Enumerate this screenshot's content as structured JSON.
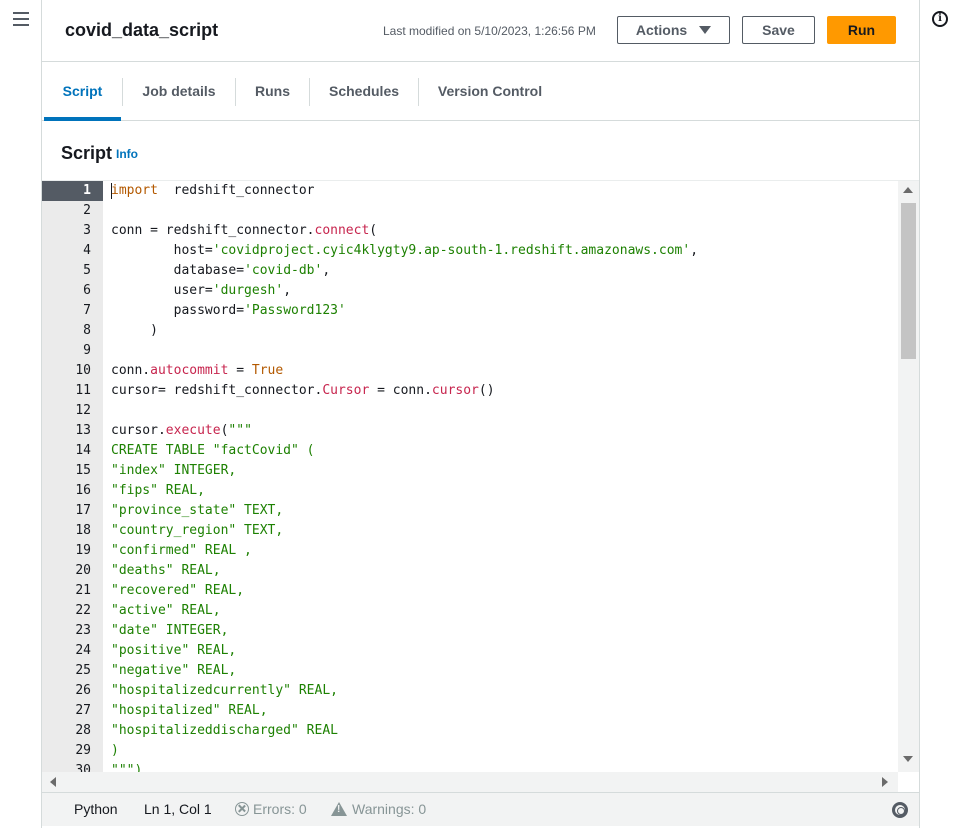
{
  "header": {
    "title": "covid_data_script",
    "last_modified": "Last modified on 5/10/2023, 1:26:56 PM",
    "actions_label": "Actions",
    "save_label": "Save",
    "run_label": "Run"
  },
  "tabs": [
    {
      "label": "Script",
      "active": true
    },
    {
      "label": "Job details",
      "active": false
    },
    {
      "label": "Runs",
      "active": false
    },
    {
      "label": "Schedules",
      "active": false
    },
    {
      "label": "Version Control",
      "active": false
    }
  ],
  "script_section": {
    "title": "Script",
    "info_link": "Info"
  },
  "editor": {
    "current_line": 1,
    "lines": [
      {
        "n": "1",
        "segs": [
          [
            "kw",
            "import"
          ],
          [
            "",
            "  redshift_connector"
          ]
        ]
      },
      {
        "n": "2",
        "segs": [
          [
            "",
            ""
          ]
        ]
      },
      {
        "n": "3",
        "segs": [
          [
            "",
            "conn = redshift_connector."
          ],
          [
            "fn",
            "connect"
          ],
          [
            "",
            "("
          ]
        ]
      },
      {
        "n": "4",
        "segs": [
          [
            "",
            "        host="
          ],
          [
            "str",
            "'covidproject.cyic4klygty9.ap-south-1.redshift.amazonaws.com'"
          ],
          [
            "",
            ","
          ]
        ]
      },
      {
        "n": "5",
        "segs": [
          [
            "",
            "        database="
          ],
          [
            "str",
            "'covid-db'"
          ],
          [
            "",
            ","
          ]
        ]
      },
      {
        "n": "6",
        "segs": [
          [
            "",
            "        user="
          ],
          [
            "str",
            "'durgesh'"
          ],
          [
            "",
            ","
          ]
        ]
      },
      {
        "n": "7",
        "segs": [
          [
            "",
            "        password="
          ],
          [
            "str",
            "'Password123'"
          ]
        ]
      },
      {
        "n": "8",
        "segs": [
          [
            "",
            "     )"
          ]
        ]
      },
      {
        "n": "9",
        "segs": [
          [
            "",
            ""
          ]
        ]
      },
      {
        "n": "10",
        "segs": [
          [
            "",
            "conn."
          ],
          [
            "fn",
            "autocommit"
          ],
          [
            "",
            " = "
          ],
          [
            "kw",
            "True"
          ]
        ]
      },
      {
        "n": "11",
        "segs": [
          [
            "",
            "cursor= redshift_connector."
          ],
          [
            "fn",
            "Cursor"
          ],
          [
            "",
            " = conn."
          ],
          [
            "fn",
            "cursor"
          ],
          [
            "",
            "()"
          ]
        ]
      },
      {
        "n": "12",
        "segs": [
          [
            "",
            ""
          ]
        ]
      },
      {
        "n": "13",
        "segs": [
          [
            "",
            "cursor."
          ],
          [
            "fn",
            "execute"
          ],
          [
            "",
            "("
          ],
          [
            "str",
            "\"\"\""
          ]
        ]
      },
      {
        "n": "14",
        "segs": [
          [
            "str",
            "CREATE TABLE \"factCovid\" ("
          ]
        ]
      },
      {
        "n": "15",
        "segs": [
          [
            "str",
            "\"index\" INTEGER,"
          ]
        ]
      },
      {
        "n": "16",
        "segs": [
          [
            "str",
            "\"fips\" REAL,"
          ]
        ]
      },
      {
        "n": "17",
        "segs": [
          [
            "str",
            "\"province_state\" TEXT,"
          ]
        ]
      },
      {
        "n": "18",
        "segs": [
          [
            "str",
            "\"country_region\" TEXT,"
          ]
        ]
      },
      {
        "n": "19",
        "segs": [
          [
            "str",
            "\"confirmed\" REAL ,"
          ]
        ]
      },
      {
        "n": "20",
        "segs": [
          [
            "str",
            "\"deaths\" REAL,"
          ]
        ]
      },
      {
        "n": "21",
        "segs": [
          [
            "str",
            "\"recovered\" REAL,"
          ]
        ]
      },
      {
        "n": "22",
        "segs": [
          [
            "str",
            "\"active\" REAL,"
          ]
        ]
      },
      {
        "n": "23",
        "segs": [
          [
            "str",
            "\"date\" INTEGER,"
          ]
        ]
      },
      {
        "n": "24",
        "segs": [
          [
            "str",
            "\"positive\" REAL,"
          ]
        ]
      },
      {
        "n": "25",
        "segs": [
          [
            "str",
            "\"negative\" REAL,"
          ]
        ]
      },
      {
        "n": "26",
        "segs": [
          [
            "str",
            "\"hospitalizedcurrently\" REAL,"
          ]
        ]
      },
      {
        "n": "27",
        "segs": [
          [
            "str",
            "\"hospitalized\" REAL,"
          ]
        ]
      },
      {
        "n": "28",
        "segs": [
          [
            "str",
            "\"hospitalizeddischarged\" REAL"
          ]
        ]
      },
      {
        "n": "29",
        "segs": [
          [
            "str",
            ")"
          ]
        ]
      },
      {
        "n": "30",
        "segs": [
          [
            "str",
            "\"\"\")"
          ]
        ]
      }
    ]
  },
  "statusbar": {
    "language": "Python",
    "position": "Ln 1, Col 1",
    "errors": "Errors: 0",
    "warnings": "Warnings: 0"
  },
  "colors": {
    "accent": "#0073bb",
    "run_button": "#ff9900",
    "string": "#1d8102"
  },
  "icons": {
    "menu": "hamburger-icon",
    "help": "info-icon",
    "actions_caret": "caret-down-icon",
    "errors": "error-circle-icon",
    "warnings": "warning-triangle-icon",
    "settings": "gear-icon"
  }
}
